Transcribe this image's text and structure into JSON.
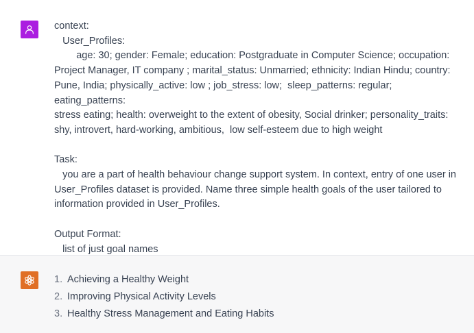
{
  "conversation": {
    "user_message": {
      "avatar_icon": "user-icon",
      "avatar_color": "#ab1ee0",
      "lines": [
        "context:",
        "   User_Profiles:",
        "        age: 30; gender: Female; education: Postgraduate in Computer Science; occupation:",
        "Project Manager, IT company ; marital_status: Unmarried; ethnicity: Indian Hindu; country:",
        "Pune, India; physically_active: low ; job_stress: low;  sleep_patterns: regular; eating_patterns:",
        "stress eating; health: overweight to the extent of obesity, Social drinker; personality_traits:",
        "shy, introvert, hard-working, ambitious,  low self-esteem due to high weight",
        "",
        "Task:",
        "   you are a part of health behaviour change support system. In context, entry of one user in",
        "User_Profiles dataset is provided. Name three simple health goals of the user tailored to",
        "information provided in User_Profiles.",
        "",
        "Output Format:",
        "   list of just goal names"
      ]
    },
    "assistant_message": {
      "avatar_icon": "openai-logo-icon",
      "avatar_color": "#e06f26",
      "items": [
        {
          "number": "1.",
          "text": "Achieving a Healthy Weight"
        },
        {
          "number": "2.",
          "text": "Improving Physical Activity Levels"
        },
        {
          "number": "3.",
          "text": "Healthy Stress Management and Eating Habits"
        }
      ]
    }
  }
}
